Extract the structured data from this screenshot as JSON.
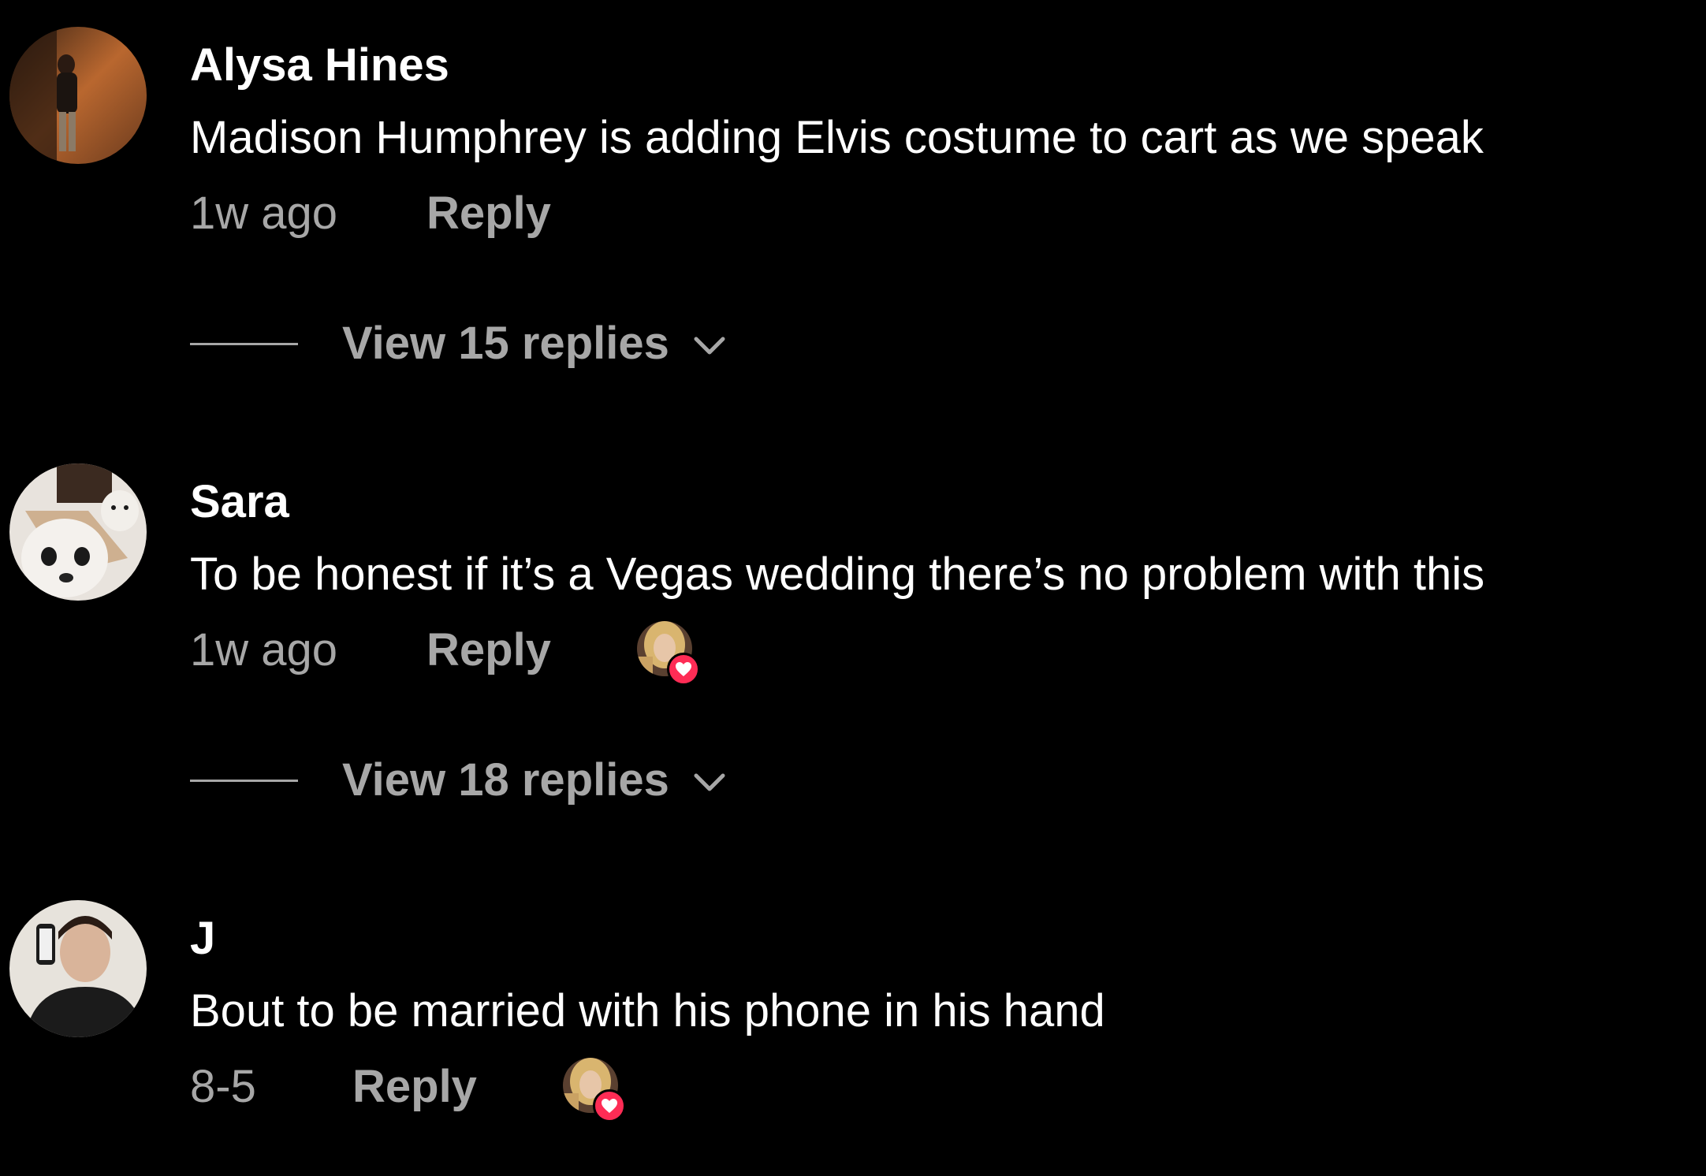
{
  "colors": {
    "background": "#000000",
    "text_primary": "#ffffff",
    "text_secondary": "#a7a7a7",
    "like_badge": "#fe2c55"
  },
  "comments": [
    {
      "username": "Alysa Hines",
      "text": "Madison Humphrey is adding Elvis costume to cart as we speak",
      "timestamp": "1w ago",
      "reply_label": "Reply",
      "liked_by_creator": false,
      "view_replies_label": "View 15 replies",
      "avatar_icon": "user-avatar-photo"
    },
    {
      "username": "Sara",
      "text": "To be honest if it’s a Vegas wedding there’s no problem with this",
      "timestamp": "1w ago",
      "reply_label": "Reply",
      "liked_by_creator": true,
      "view_replies_label": "View 18 replies",
      "avatar_icon": "user-avatar-photo"
    },
    {
      "username": "J",
      "text": "Bout to be married with his phone in his hand",
      "timestamp": "8-5",
      "reply_label": "Reply",
      "liked_by_creator": true,
      "avatar_icon": "user-avatar-photo"
    }
  ]
}
